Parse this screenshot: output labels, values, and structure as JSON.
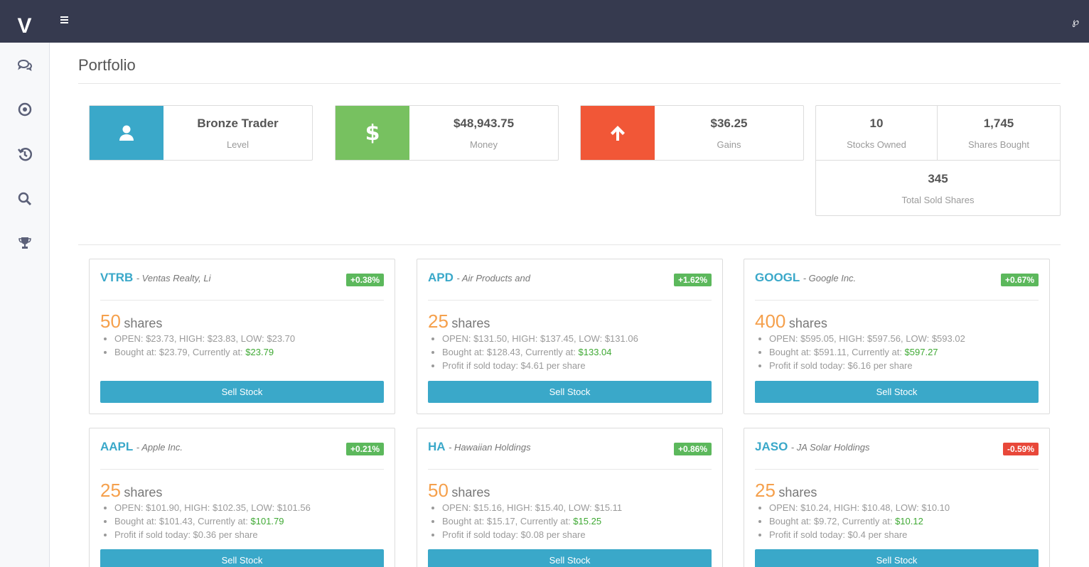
{
  "app": {
    "logo_text": "V"
  },
  "header": {
    "menu_icon": "hamburger-icon",
    "right_icon": "user-icon",
    "right_glyph": "℘"
  },
  "sidebar": {
    "items": [
      {
        "icon": "chat-icon"
      },
      {
        "icon": "target-icon"
      },
      {
        "icon": "history-icon"
      },
      {
        "icon": "search-icon"
      },
      {
        "icon": "trophy-icon"
      }
    ]
  },
  "page": {
    "title": "Portfolio"
  },
  "stats": [
    {
      "value": "Bronze Trader",
      "label": "Level",
      "icon": "user-icon",
      "color": "#3aa8c9"
    },
    {
      "value": "$48,943.75",
      "label": "Money",
      "icon": "dollar-icon",
      "color": "#77c160"
    },
    {
      "value": "$36.25",
      "label": "Gains",
      "icon": "arrow-up-icon",
      "color": "#f15737"
    }
  ],
  "summary": {
    "stocks_owned": {
      "value": "10",
      "label": "Stocks Owned"
    },
    "shares_bought": {
      "value": "1,745",
      "label": "Shares Bought"
    },
    "total_sold": {
      "value": "345",
      "label": "Total Sold Shares"
    }
  },
  "colors": {
    "accent": "#3aa8c9",
    "gain": "#5cb85c",
    "loss": "#e8483a",
    "shares": "#f5a04c",
    "topbar": "#363a4f"
  },
  "stocks": [
    {
      "ticker": "VTRB",
      "company": "- Ventas Realty, Li",
      "change": "+0.38%",
      "direction": "up",
      "shares_count": "50",
      "shares_word": "shares",
      "ohl": "OPEN: $23.73, HIGH: $23.83, LOW: $23.70",
      "bought_prefix": "Bought at: $23.79, Currently at: ",
      "current": "$23.79",
      "profit": "",
      "button": "Sell Stock"
    },
    {
      "ticker": "APD",
      "company": "- Air Products and",
      "change": "+1.62%",
      "direction": "up",
      "shares_count": "25",
      "shares_word": "shares",
      "ohl": "OPEN: $131.50, HIGH: $137.45, LOW: $131.06",
      "bought_prefix": "Bought at: $128.43, Currently at: ",
      "current": "$133.04",
      "profit": "Profit if sold today: $4.61 per share",
      "button": "Sell Stock"
    },
    {
      "ticker": "GOOGL",
      "company": "- Google Inc.",
      "change": "+0.67%",
      "direction": "up",
      "shares_count": "400",
      "shares_word": "shares",
      "ohl": "OPEN: $595.05, HIGH: $597.56, LOW: $593.02",
      "bought_prefix": "Bought at: $591.11, Currently at: ",
      "current": "$597.27",
      "profit": "Profit if sold today: $6.16 per share",
      "button": "Sell Stock"
    },
    {
      "ticker": "AAPL",
      "company": "- Apple Inc.",
      "change": "+0.21%",
      "direction": "up",
      "shares_count": "25",
      "shares_word": "shares",
      "ohl": "OPEN: $101.90, HIGH: $102.35, LOW: $101.56",
      "bought_prefix": "Bought at: $101.43, Currently at: ",
      "current": "$101.79",
      "profit": "Profit if sold today: $0.36 per share",
      "button": "Sell Stock"
    },
    {
      "ticker": "HA",
      "company": "- Hawaiian Holdings",
      "change": "+0.86%",
      "direction": "up",
      "shares_count": "50",
      "shares_word": "shares",
      "ohl": "OPEN: $15.16, HIGH: $15.40, LOW: $15.11",
      "bought_prefix": "Bought at: $15.17, Currently at: ",
      "current": "$15.25",
      "profit": "Profit if sold today: $0.08 per share",
      "button": "Sell Stock"
    },
    {
      "ticker": "JASO",
      "company": "- JA Solar Holdings",
      "change": "-0.59%",
      "direction": "down",
      "shares_count": "25",
      "shares_word": "shares",
      "ohl": "OPEN: $10.24, HIGH: $10.48, LOW: $10.10",
      "bought_prefix": "Bought at: $9.72, Currently at: ",
      "current": "$10.12",
      "profit": "Profit if sold today: $0.4 per share",
      "button": "Sell Stock"
    }
  ]
}
